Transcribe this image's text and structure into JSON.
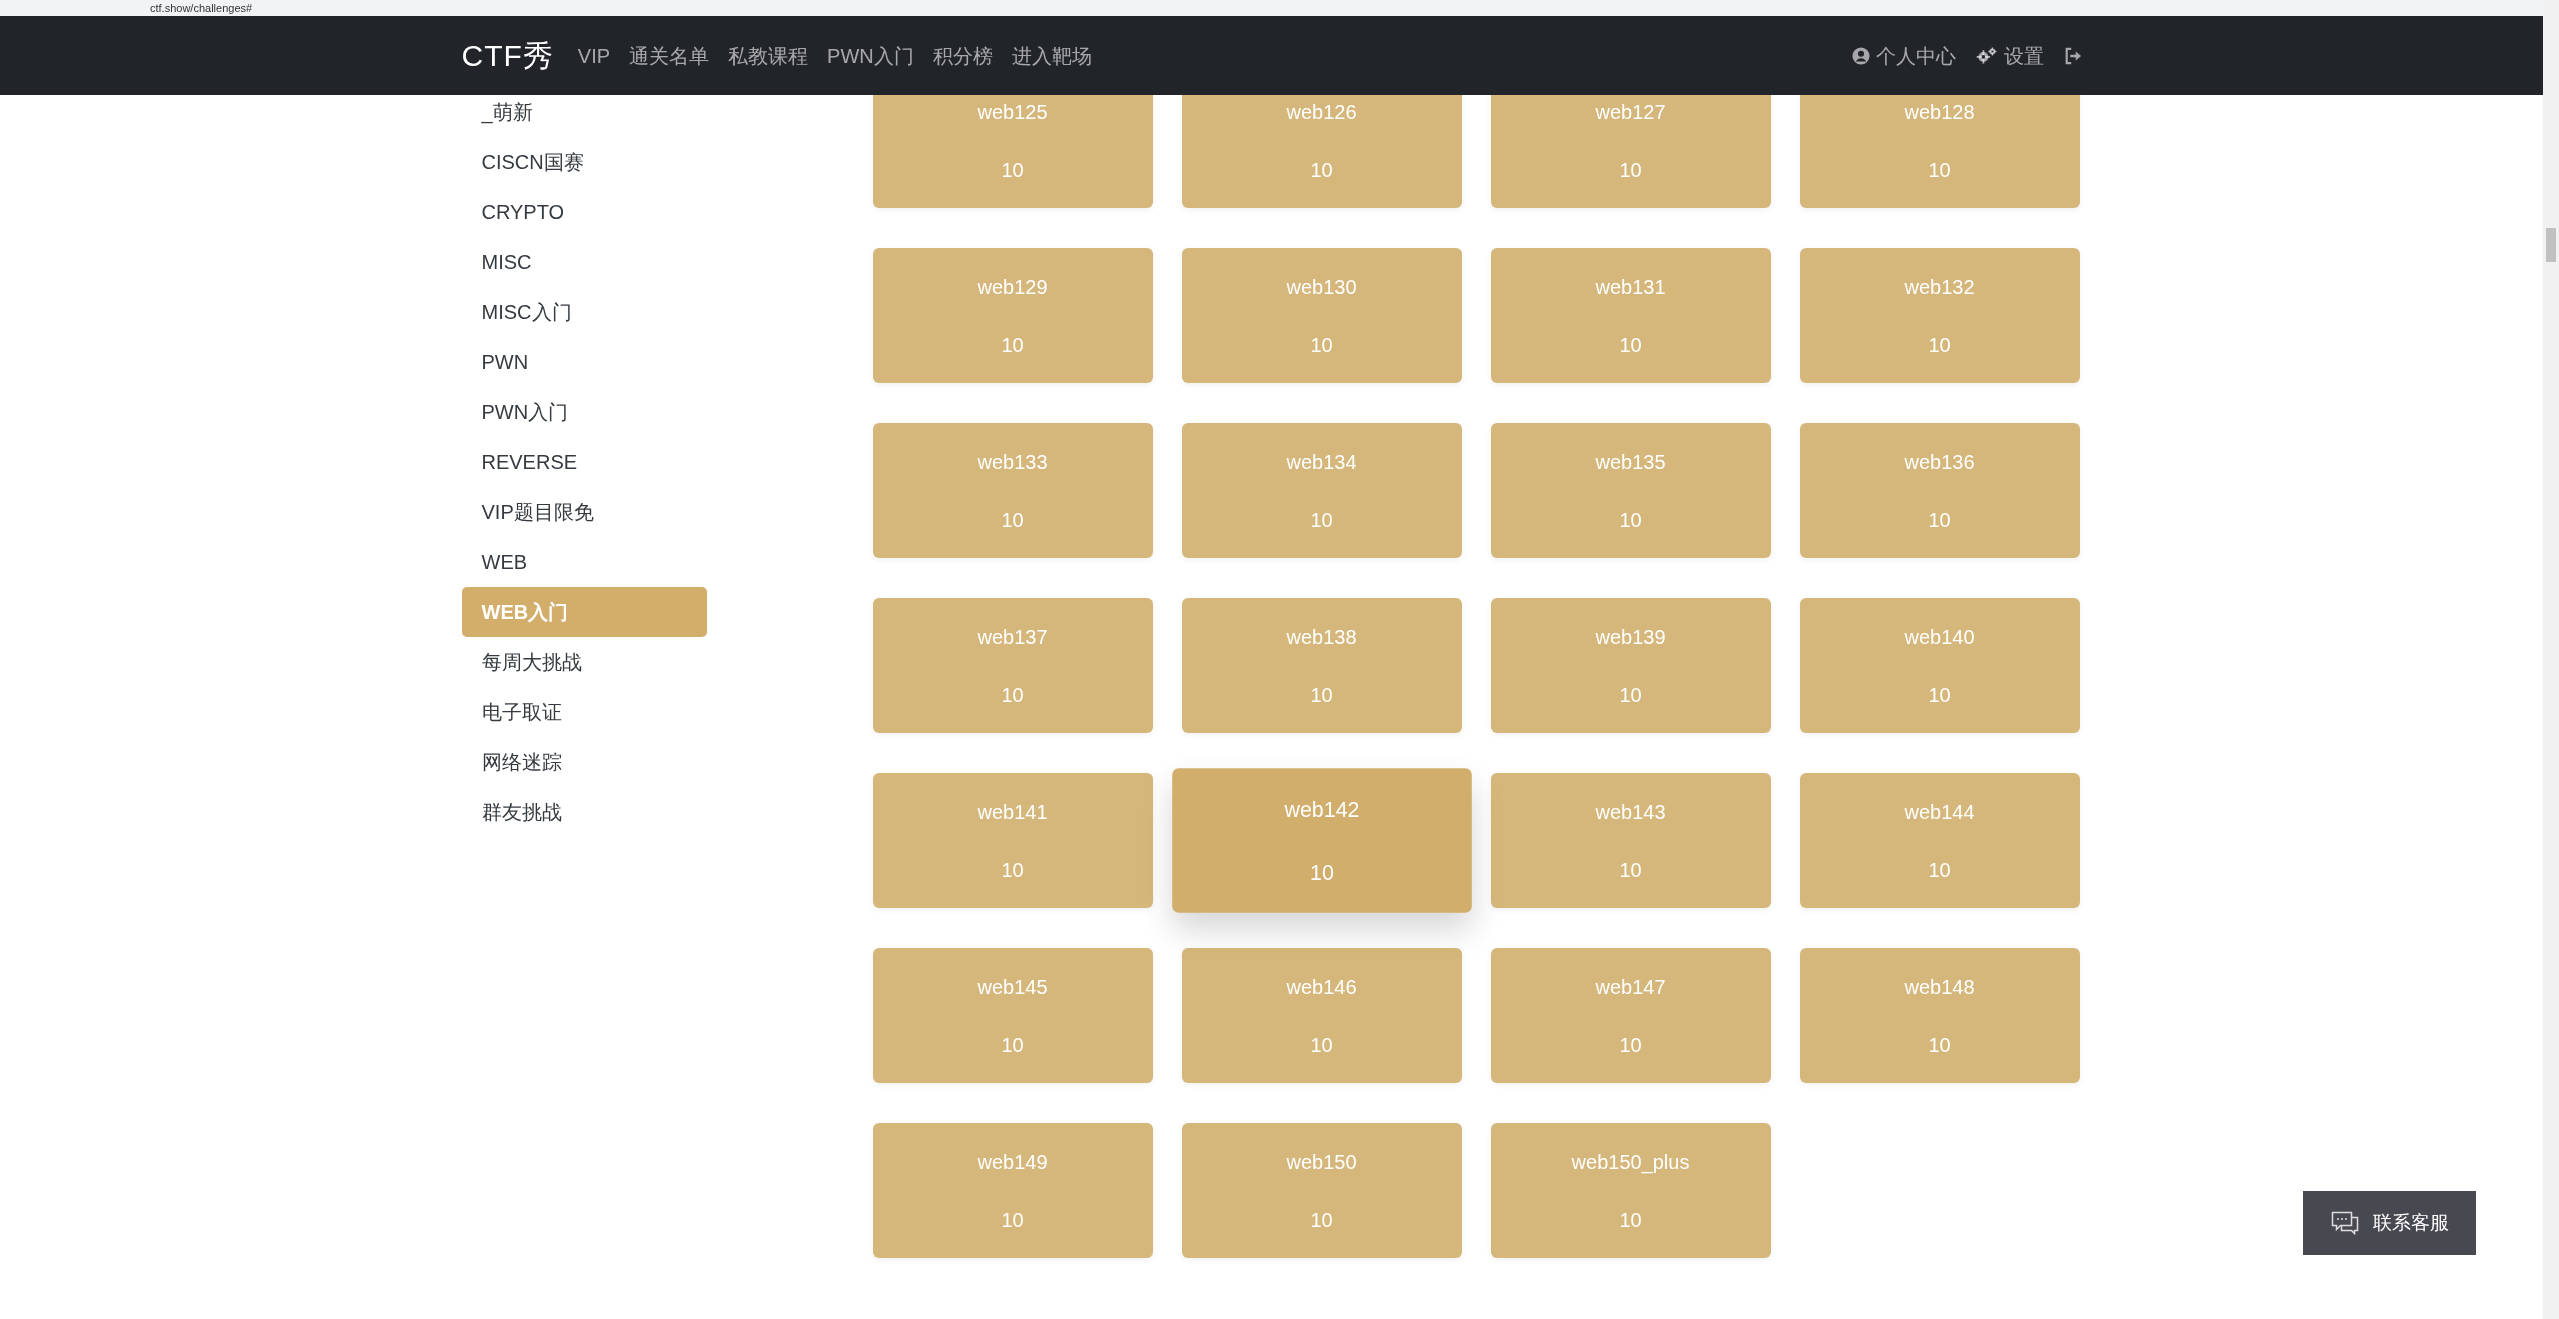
{
  "browser": {
    "url": "ctf.show/challenges#"
  },
  "navbar": {
    "logo": "CTF秀",
    "links": [
      {
        "label": "VIP"
      },
      {
        "label": "通关名单"
      },
      {
        "label": "私教课程"
      },
      {
        "label": "PWN入门"
      },
      {
        "label": "积分榜"
      },
      {
        "label": "进入靶场"
      }
    ],
    "user_links": [
      {
        "kind": "user",
        "label": "个人中心"
      },
      {
        "kind": "settings",
        "label": "设置"
      },
      {
        "kind": "logout"
      }
    ]
  },
  "sidebar": {
    "items": [
      {
        "label": "_萌新",
        "selected": false
      },
      {
        "label": "CISCN国赛",
        "selected": false
      },
      {
        "label": "CRYPTO",
        "selected": false
      },
      {
        "label": "MISC",
        "selected": false
      },
      {
        "label": "MISC入门",
        "selected": false
      },
      {
        "label": "PWN",
        "selected": false
      },
      {
        "label": "PWN入门",
        "selected": false
      },
      {
        "label": "REVERSE",
        "selected": false
      },
      {
        "label": "VIP题目限免",
        "selected": false
      },
      {
        "label": "WEB",
        "selected": false
      },
      {
        "label": "WEB入门",
        "selected": true
      },
      {
        "label": "每周大挑战",
        "selected": false
      },
      {
        "label": "电子取证",
        "selected": false
      },
      {
        "label": "网络迷踪",
        "selected": false
      },
      {
        "label": "群友挑战",
        "selected": false
      }
    ]
  },
  "challenges": [
    {
      "name": "web125",
      "points": "10",
      "hovered": false
    },
    {
      "name": "web126",
      "points": "10",
      "hovered": false
    },
    {
      "name": "web127",
      "points": "10",
      "hovered": false
    },
    {
      "name": "web128",
      "points": "10",
      "hovered": false
    },
    {
      "name": "web129",
      "points": "10",
      "hovered": false
    },
    {
      "name": "web130",
      "points": "10",
      "hovered": false
    },
    {
      "name": "web131",
      "points": "10",
      "hovered": false
    },
    {
      "name": "web132",
      "points": "10",
      "hovered": false
    },
    {
      "name": "web133",
      "points": "10",
      "hovered": false
    },
    {
      "name": "web134",
      "points": "10",
      "hovered": false
    },
    {
      "name": "web135",
      "points": "10",
      "hovered": false
    },
    {
      "name": "web136",
      "points": "10",
      "hovered": false
    },
    {
      "name": "web137",
      "points": "10",
      "hovered": false
    },
    {
      "name": "web138",
      "points": "10",
      "hovered": false
    },
    {
      "name": "web139",
      "points": "10",
      "hovered": false
    },
    {
      "name": "web140",
      "points": "10",
      "hovered": false
    },
    {
      "name": "web141",
      "points": "10",
      "hovered": false
    },
    {
      "name": "web142",
      "points": "10",
      "hovered": true
    },
    {
      "name": "web143",
      "points": "10",
      "hovered": false
    },
    {
      "name": "web144",
      "points": "10",
      "hovered": false
    },
    {
      "name": "web145",
      "points": "10",
      "hovered": false
    },
    {
      "name": "web146",
      "points": "10",
      "hovered": false
    },
    {
      "name": "web147",
      "points": "10",
      "hovered": false
    },
    {
      "name": "web148",
      "points": "10",
      "hovered": false
    },
    {
      "name": "web149",
      "points": "10",
      "hovered": false
    },
    {
      "name": "web150",
      "points": "10",
      "hovered": false
    },
    {
      "name": "web150_plus",
      "points": "10",
      "hovered": false
    }
  ],
  "chat_button": {
    "label": "联系客服"
  }
}
